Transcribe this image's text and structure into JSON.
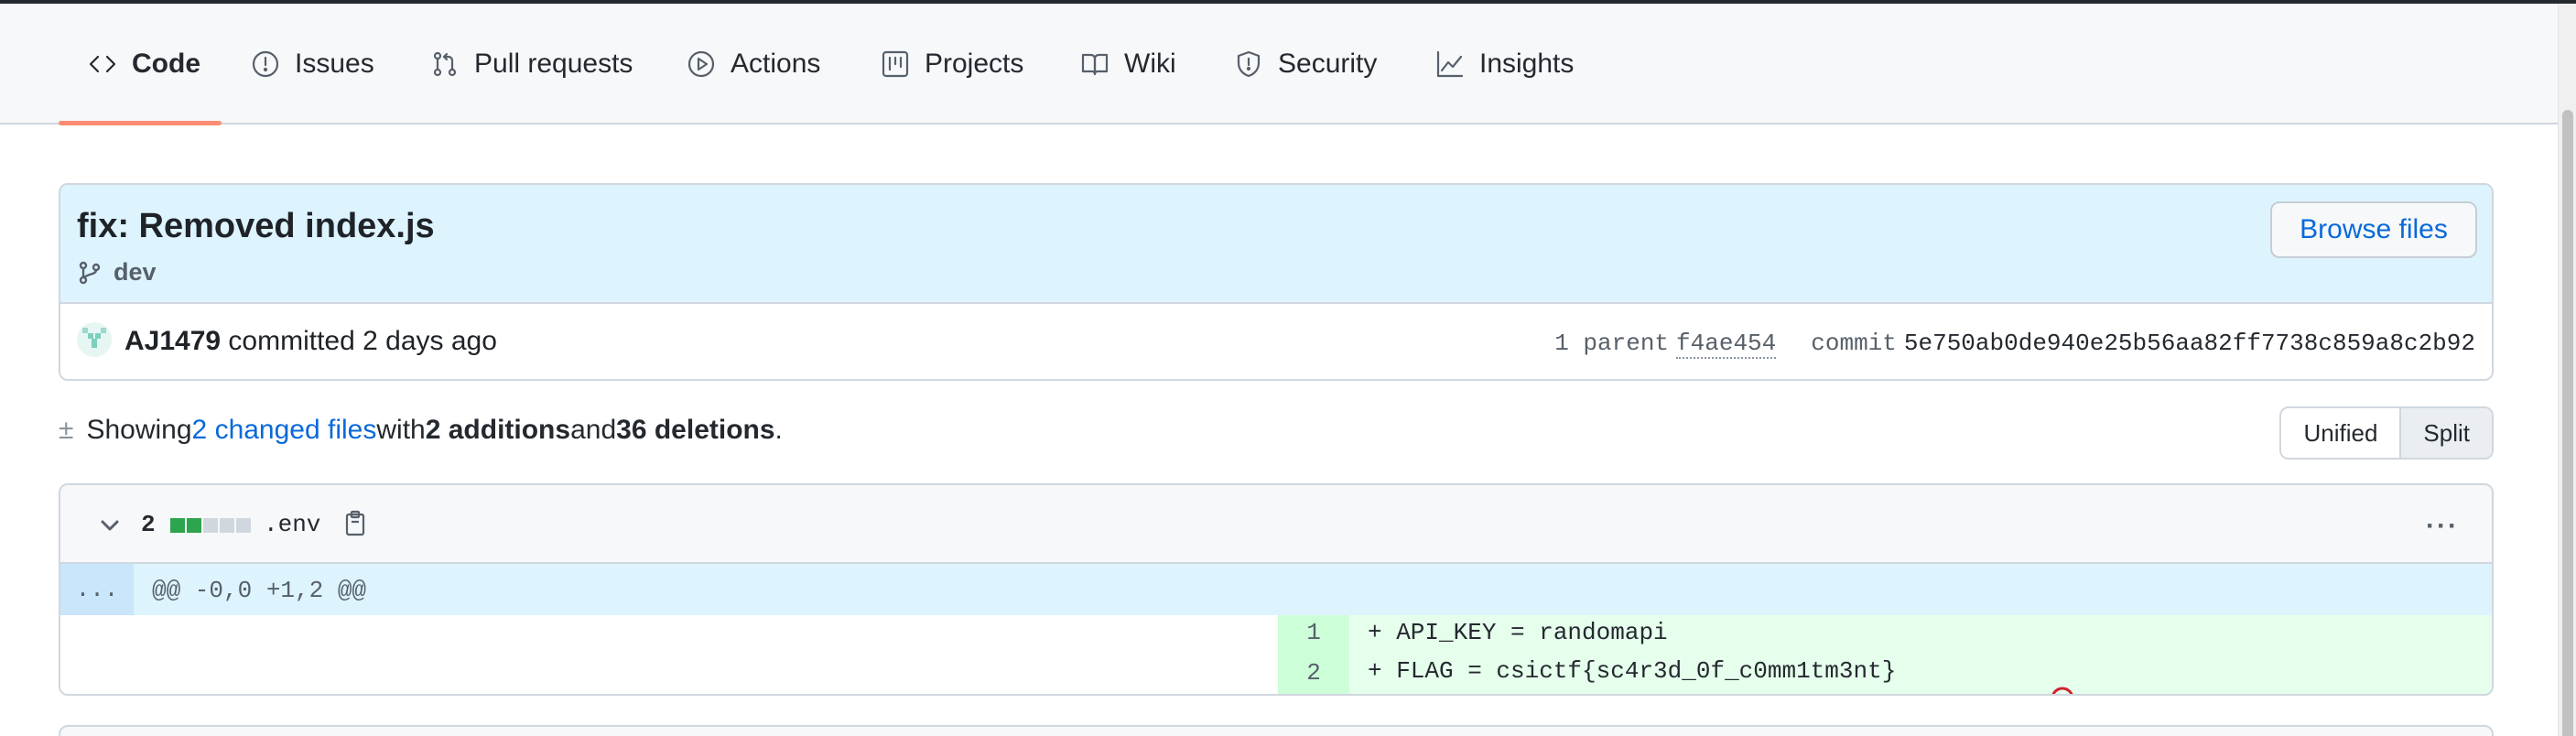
{
  "nav": {
    "tabs": [
      {
        "label": "Code",
        "icon": "code-icon",
        "selected": true
      },
      {
        "label": "Issues",
        "icon": "issue-icon"
      },
      {
        "label": "Pull requests",
        "icon": "pull-request-icon"
      },
      {
        "label": "Actions",
        "icon": "play-icon"
      },
      {
        "label": "Projects",
        "icon": "project-icon"
      },
      {
        "label": "Wiki",
        "icon": "book-icon"
      },
      {
        "label": "Security",
        "icon": "shield-icon"
      },
      {
        "label": "Insights",
        "icon": "graph-icon"
      }
    ]
  },
  "commit": {
    "title": "fix: Removed index.js",
    "branch": "dev",
    "browse_label": "Browse files",
    "author": "AJ1479",
    "committed_text": " committed 2 days ago",
    "parent_label": "1 parent",
    "parent_sha": "f4ae454",
    "commit_label": "commit",
    "commit_sha": "5e750ab0de940e25b56aa82ff7738c859a8c2b92"
  },
  "summary": {
    "prefix": "Showing ",
    "changed_files": "2 changed files",
    "with": " with ",
    "additions": "2 additions",
    "and": " and ",
    "deletions": "36 deletions",
    "suffix": ".",
    "unified_label": "Unified",
    "split_label": "Split"
  },
  "file": {
    "change_count": "2",
    "name": ".env",
    "diffstat": [
      "add",
      "add",
      "neutral",
      "neutral",
      "neutral"
    ],
    "hunk_expand": "...",
    "hunk_header": "@@ -0,0 +1,2 @@",
    "lines": [
      {
        "num": "1",
        "code": "+ API_KEY = randomapi"
      },
      {
        "num": "2",
        "code": "+ FLAG = csictf{sc4r3d_0f_c0mm1tm3nt}"
      }
    ]
  },
  "colors": {
    "accent_link": "#0969da",
    "tab_underline": "#fd8c73",
    "addition_bg": "#e6ffec",
    "addition_num_bg": "#ccffd8",
    "hunk_bg": "#ddf4ff"
  }
}
